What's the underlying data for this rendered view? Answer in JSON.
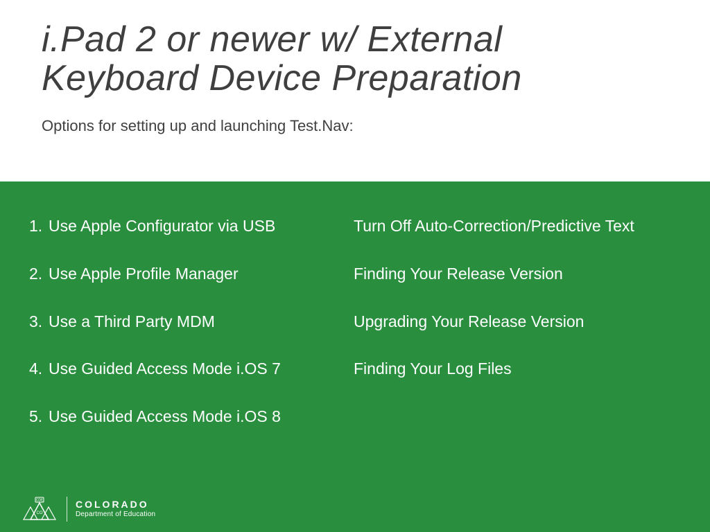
{
  "title": "i.Pad 2 or newer w/ External Keyboard Device Preparation",
  "subtitle": "Options for setting up and launching Test.Nav:",
  "rows": [
    {
      "num": "1.",
      "left": "Use Apple Configurator via USB",
      "right": "Turn Off Auto-Correction/Predictive Text"
    },
    {
      "num": "2.",
      "left": "Use Apple Profile Manager",
      "right": "Finding Your Release Version"
    },
    {
      "num": "3.",
      "left": "Use a Third Party MDM",
      "right": "Upgrading Your Release Version"
    },
    {
      "num": "4.",
      "left": "Use Guided Access Mode i.OS 7",
      "right": "Finding Your Log Files"
    },
    {
      "num": "5.",
      "left": "Use Guided Access Mode i.OS 8",
      "right": ""
    }
  ],
  "logo": {
    "badge_label": "CDE",
    "state": "COLORADO",
    "dept": "Department of Education"
  }
}
